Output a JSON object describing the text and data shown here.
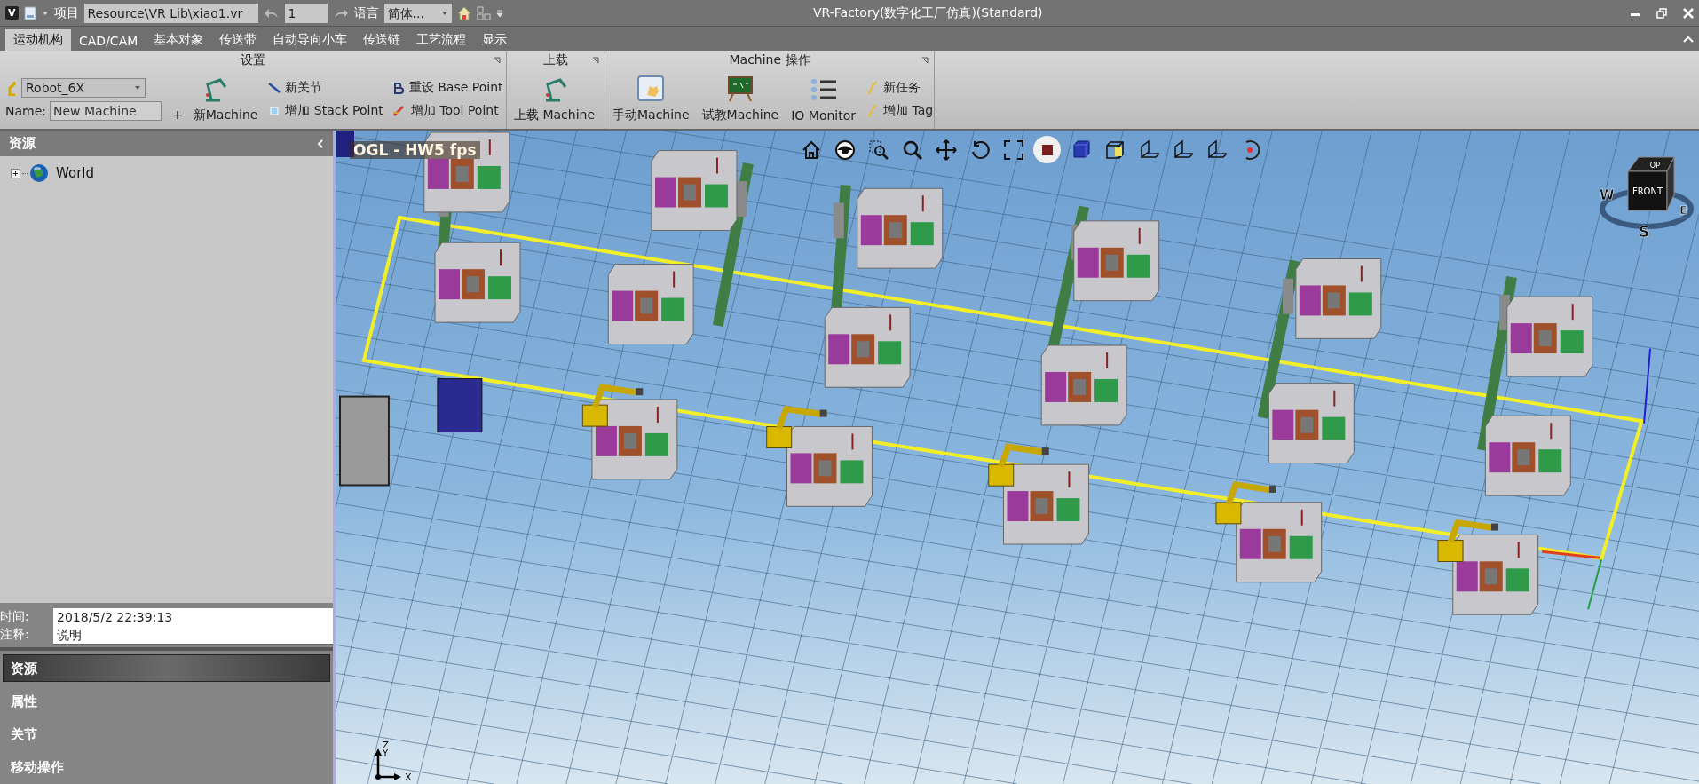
{
  "title_bar": {
    "logo": "V",
    "project_label": "项目",
    "project_path": "Resource\\VR Lib\\xiao1.vr",
    "step": "1",
    "language_label": "语言",
    "language": "简体...",
    "title": "VR-Factory(数字化工厂仿真)(Standard)"
  },
  "tabs": [
    {
      "label": "运动机构",
      "selected": true
    },
    {
      "label": "CAD/CAM",
      "selected": false
    },
    {
      "label": "基本对象",
      "selected": false
    },
    {
      "label": "传送带",
      "selected": false
    },
    {
      "label": "自动导向小车",
      "selected": false
    },
    {
      "label": "传送链",
      "selected": false
    },
    {
      "label": "工艺流程",
      "selected": false
    },
    {
      "label": "显示",
      "selected": false
    }
  ],
  "settings_group": {
    "title": "设置",
    "robot_type": "Robot_6X",
    "name_label": "Name:",
    "name_value": "New Machine",
    "new_machine_sign": "+",
    "new_machine": "新Machine",
    "new_joint": "新关节",
    "add_stack_point": "增加 Stack Point",
    "reset_base_point": "重设 Base Point",
    "add_tool_point": "增加 Tool Point"
  },
  "load_group": {
    "title": "上载",
    "load_machine": "上载 Machine"
  },
  "machine_group": {
    "title": "Machine 操作",
    "manual": "手动Machine",
    "teach": "试教Machine",
    "io_monitor": "IO Monitor",
    "new_task": "新任务",
    "add_tag": "增加 Tag"
  },
  "resources_panel": {
    "title": "资源",
    "tree": [
      {
        "label": "World",
        "expanded": false
      }
    ]
  },
  "info": {
    "time_label": "时间:",
    "time": "2018/5/2 22:39:13",
    "note_label": "注释:",
    "note": "说明"
  },
  "accordion": [
    {
      "label": "资源",
      "selected": true
    },
    {
      "label": "属性",
      "selected": false
    },
    {
      "label": "关节",
      "selected": false
    },
    {
      "label": "移动操作",
      "selected": false
    }
  ],
  "viewport": {
    "overlay": "OGL - HW5 fps",
    "tools": [
      {
        "kind": "home",
        "selected": false
      },
      {
        "kind": "eye",
        "selected": false
      },
      {
        "kind": "zoom-box",
        "selected": false
      },
      {
        "kind": "zoom",
        "selected": false
      },
      {
        "kind": "pan",
        "selected": false
      },
      {
        "kind": "rotate",
        "selected": false
      },
      {
        "kind": "fit",
        "selected": false
      },
      {
        "kind": "stop",
        "selected": true
      },
      {
        "kind": "solid",
        "selected": false
      },
      {
        "kind": "wire",
        "selected": false
      },
      {
        "kind": "plane",
        "selected": false
      },
      {
        "kind": "plane",
        "selected": false
      },
      {
        "kind": "plane",
        "selected": false
      },
      {
        "kind": "target",
        "selected": false
      }
    ],
    "compass": {
      "top": "TOP",
      "west": "W",
      "front": "FRONT",
      "east": "E",
      "south": "S"
    },
    "axes": {
      "z": "Z",
      "y": "Y",
      "x": "X"
    }
  }
}
